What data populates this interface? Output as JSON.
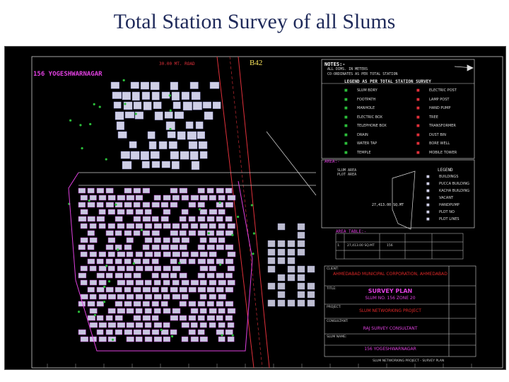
{
  "slide": {
    "title": "Total Station Survey of all Slums"
  },
  "drawing": {
    "sheet_title": "156 YOGESHWARNAGAR",
    "plot_label": "B42",
    "road_top": "30.00 MT. ROAD",
    "notes_heading": "NOTES:-",
    "notes": [
      "ALL DIMS. IN METERS",
      "CO-ORDINATES AS PER TOTAL STATION"
    ],
    "legend_heading": "LEGEND AS PER TOTAL STATION SURVEY",
    "legend_left": [
      "SLUM BDRY",
      "FOOTPATH",
      "MANHOLE",
      "ELECTRIC BOX",
      "TELEPHONE BOX",
      "DRAIN",
      "WATER TAP",
      "TEMPLE"
    ],
    "legend_right": [
      "ELECTRIC POST",
      "LAMP POST",
      "HAND PUMP",
      "TREE",
      "TRANSFORMER",
      "DUST BIN",
      "BORE WELL",
      "MOBILE TOWER"
    ],
    "area_heading": "AREA:-",
    "area_notes": [
      "SLUM AREA",
      "PLOT AREA"
    ],
    "area_value": "27,413.00 SQ.MT",
    "legend2_heading": "LEGEND",
    "legend2": [
      "BUILDINGS",
      "PUCCA BUILDING",
      "KACHA BUILDING",
      "VACANT",
      "HANDPUMP",
      "PLOT NO",
      "PLOT LINES"
    ],
    "area_table_heading": "AREA TABLE:-",
    "area_table_row": [
      "1.",
      "27,413.00 SQ.MT",
      "156"
    ],
    "client": "AHMEDABAD MUNICIPAL CORPORATION, AHMEDABAD",
    "drawing_title_1": "SURVEY PLAN",
    "drawing_title_2": "SLUM NO. 156 ZONE 20",
    "project": "SLUM NETWORKING PROJECT",
    "consultant": "RAJ SURVEY CONSULTANT",
    "slum_name": "156 YOGESHWARNAGAR",
    "tb_labels": [
      "CLIENT:",
      "TITLE:",
      "PROJECT:",
      "CONSULTANT:",
      "SLUM NAME:"
    ],
    "footer": "SLUM NETWORKING PROJECT - SURVEY PLAN"
  },
  "colors": {
    "slide_title": "#1f2a5a",
    "cad_background": "#000000",
    "road": "#e0303a",
    "buildings": "#cfcfe6",
    "plots": "#c040d0",
    "trees": "#2bbd3a"
  }
}
